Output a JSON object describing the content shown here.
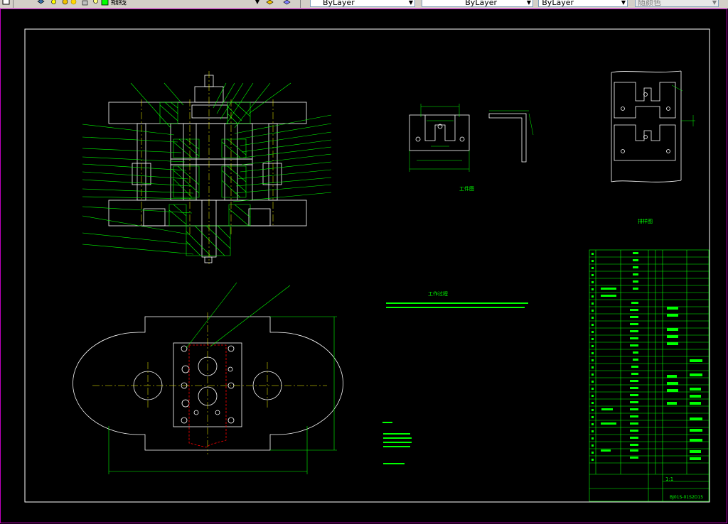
{
  "toolbar": {
    "layer_name": "细线",
    "color_value": "ByLayer",
    "linetype_value": "ByLayer",
    "lineweight_value": "ByLayer",
    "plotstyle_value": "随颜色"
  },
  "drawing": {
    "workpiece_caption": "工件图",
    "strip_caption": "排样图",
    "process_title": "工作过程",
    "scale_value": "1:1",
    "drawing_number": "BJ01S-01S2D15"
  },
  "colors": {
    "background": "#000000",
    "frame": "#ffffff",
    "leader": "#00ff00",
    "centerline": "#ffff00",
    "section": "#00ff00",
    "strip": "#ff0000",
    "dimension": "#00ff00"
  }
}
